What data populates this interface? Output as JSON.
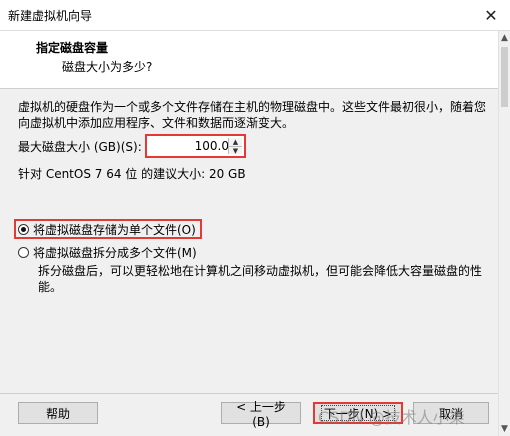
{
  "window": {
    "title": "新建虚拟机向导",
    "close_icon": "close-icon"
  },
  "header": {
    "title": "指定磁盘容量",
    "subtitle": "磁盘大小为多少?"
  },
  "description": "虚拟机的硬盘作为一个或多个文件存储在主机的物理磁盘中。这些文件最初很小，随着您向虚拟机中添加应用程序、文件和数据而逐渐变大。",
  "disk_size": {
    "label": "最大磁盘大小 (GB)(S):",
    "value": "100.0"
  },
  "recommendation": "针对 CentOS 7 64 位 的建议大小: 20 GB",
  "options": {
    "single_file": {
      "label": "将虚拟磁盘存储为单个文件(O)",
      "selected": true
    },
    "multi_file": {
      "label": "将虚拟磁盘拆分成多个文件(M)",
      "selected": false
    },
    "multi_file_desc": "拆分磁盘后，可以更轻松地在计算机之间移动虚拟机，但可能会降低大容量磁盘的性能。"
  },
  "buttons": {
    "help": "帮助",
    "back": "< 上一步(B)",
    "next": "下一步(N) >",
    "cancel": "取消"
  },
  "watermark": "CSDN @技术人小柒",
  "colors": {
    "highlight": "#e53935",
    "header_bg": "#ffffff",
    "window_bg": "#f0f0f0"
  }
}
